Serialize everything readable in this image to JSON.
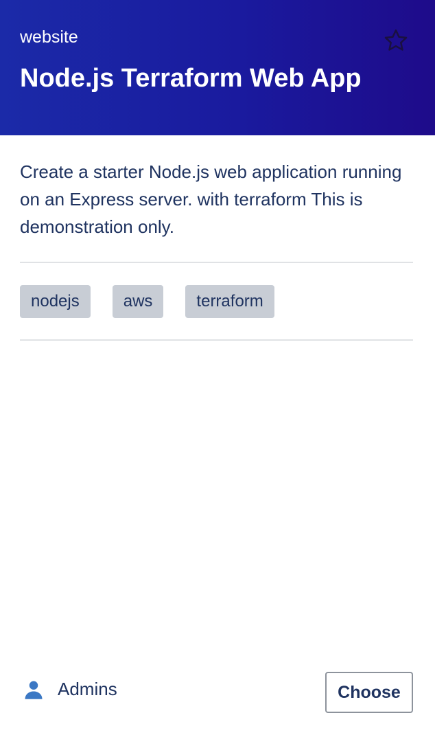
{
  "header": {
    "type_label": "website",
    "title": "Node.js Terraform Web App",
    "star_icon": "star-outline-icon"
  },
  "description": "Create a starter Node.js web application running on an Express server. with terraform This is demonstration only.",
  "tags": [
    "nodejs",
    "aws",
    "terraform"
  ],
  "footer": {
    "owner_icon": "user-icon",
    "owner": "Admins",
    "choose_label": "Choose"
  },
  "colors": {
    "header_gradient_start": "#1b2aa8",
    "header_gradient_end": "#1e0b8a",
    "text_primary": "#1f3360",
    "tag_background": "#c8cdd5",
    "user_icon": "#3b78c4"
  }
}
